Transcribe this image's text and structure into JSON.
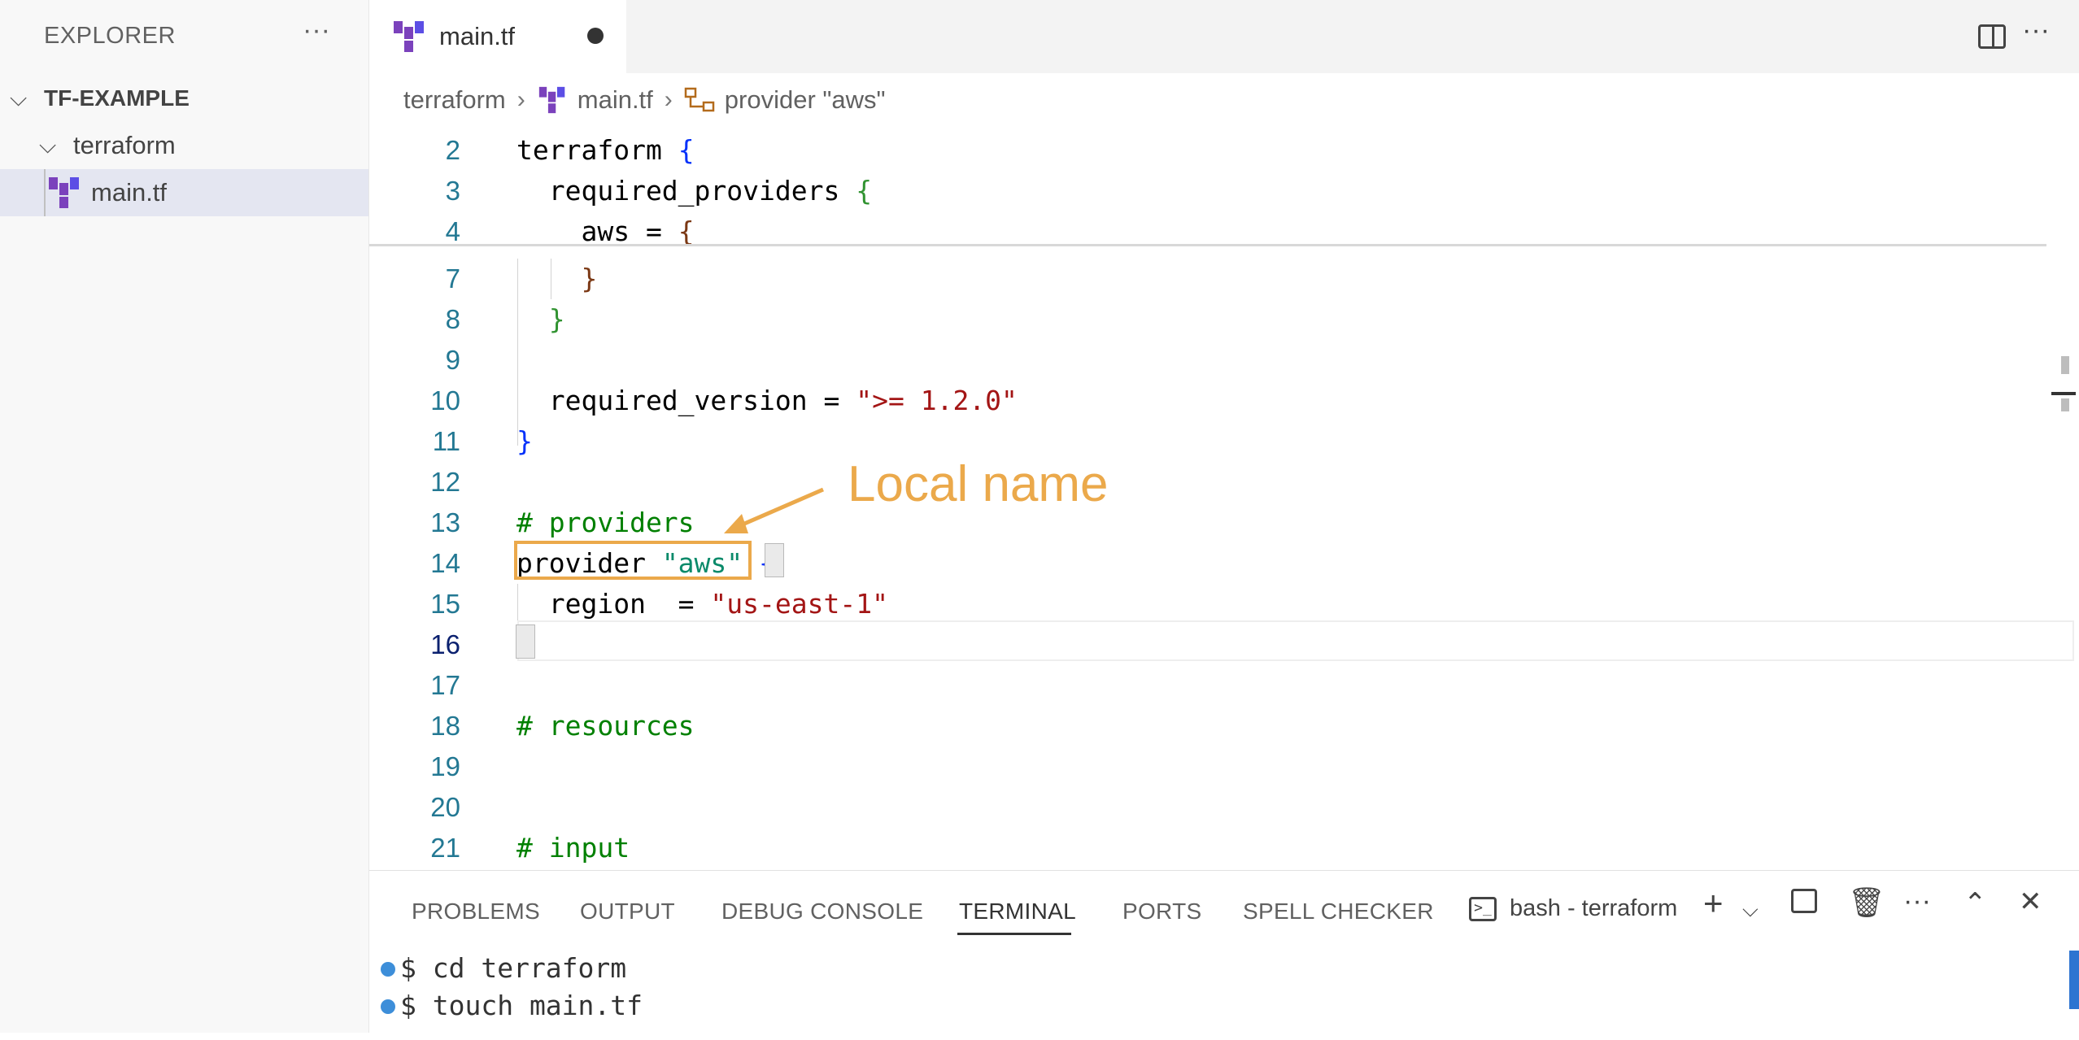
{
  "sidebar": {
    "header": "EXPLORER",
    "more": "···",
    "project": "TF-EXAMPLE",
    "folder": "terraform",
    "file": "main.tf"
  },
  "tabs": [
    {
      "label": "main.tf",
      "dirty": true
    }
  ],
  "tab_actions": {
    "more": "···"
  },
  "breadcrumb": {
    "folder": "terraform",
    "file": "main.tf",
    "symbol": "provider \"aws\""
  },
  "editor": {
    "lines": [
      {
        "n": "2",
        "text": "terraform {"
      },
      {
        "n": "3",
        "text": "  required_providers {"
      },
      {
        "n": "4",
        "text": "    aws = {"
      },
      {
        "n": "7",
        "text": "    }"
      },
      {
        "n": "8",
        "text": "  }"
      },
      {
        "n": "9",
        "text": ""
      },
      {
        "n": "10",
        "text": "  required_version = \">= 1.2.0\""
      },
      {
        "n": "11",
        "text": "}"
      },
      {
        "n": "12",
        "text": ""
      },
      {
        "n": "13",
        "text": "# providers"
      },
      {
        "n": "14",
        "text": "provider \"aws\" {"
      },
      {
        "n": "15",
        "text": "  region  = \"us-east-1\""
      },
      {
        "n": "16",
        "text": "}"
      },
      {
        "n": "17",
        "text": ""
      },
      {
        "n": "18",
        "text": "# resources"
      },
      {
        "n": "19",
        "text": ""
      },
      {
        "n": "20",
        "text": ""
      },
      {
        "n": "21",
        "text": "# input"
      }
    ],
    "current_line": "16"
  },
  "annotation": {
    "label": "Local name",
    "color": "#eba94b"
  },
  "panel": {
    "tabs": [
      "PROBLEMS",
      "OUTPUT",
      "DEBUG CONSOLE",
      "TERMINAL",
      "PORTS",
      "SPELL CHECKER"
    ],
    "active_tab": "TERMINAL",
    "terminal_name": "bash - terraform",
    "terminal_lines": [
      "$ cd terraform",
      "$ touch main.tf"
    ]
  }
}
